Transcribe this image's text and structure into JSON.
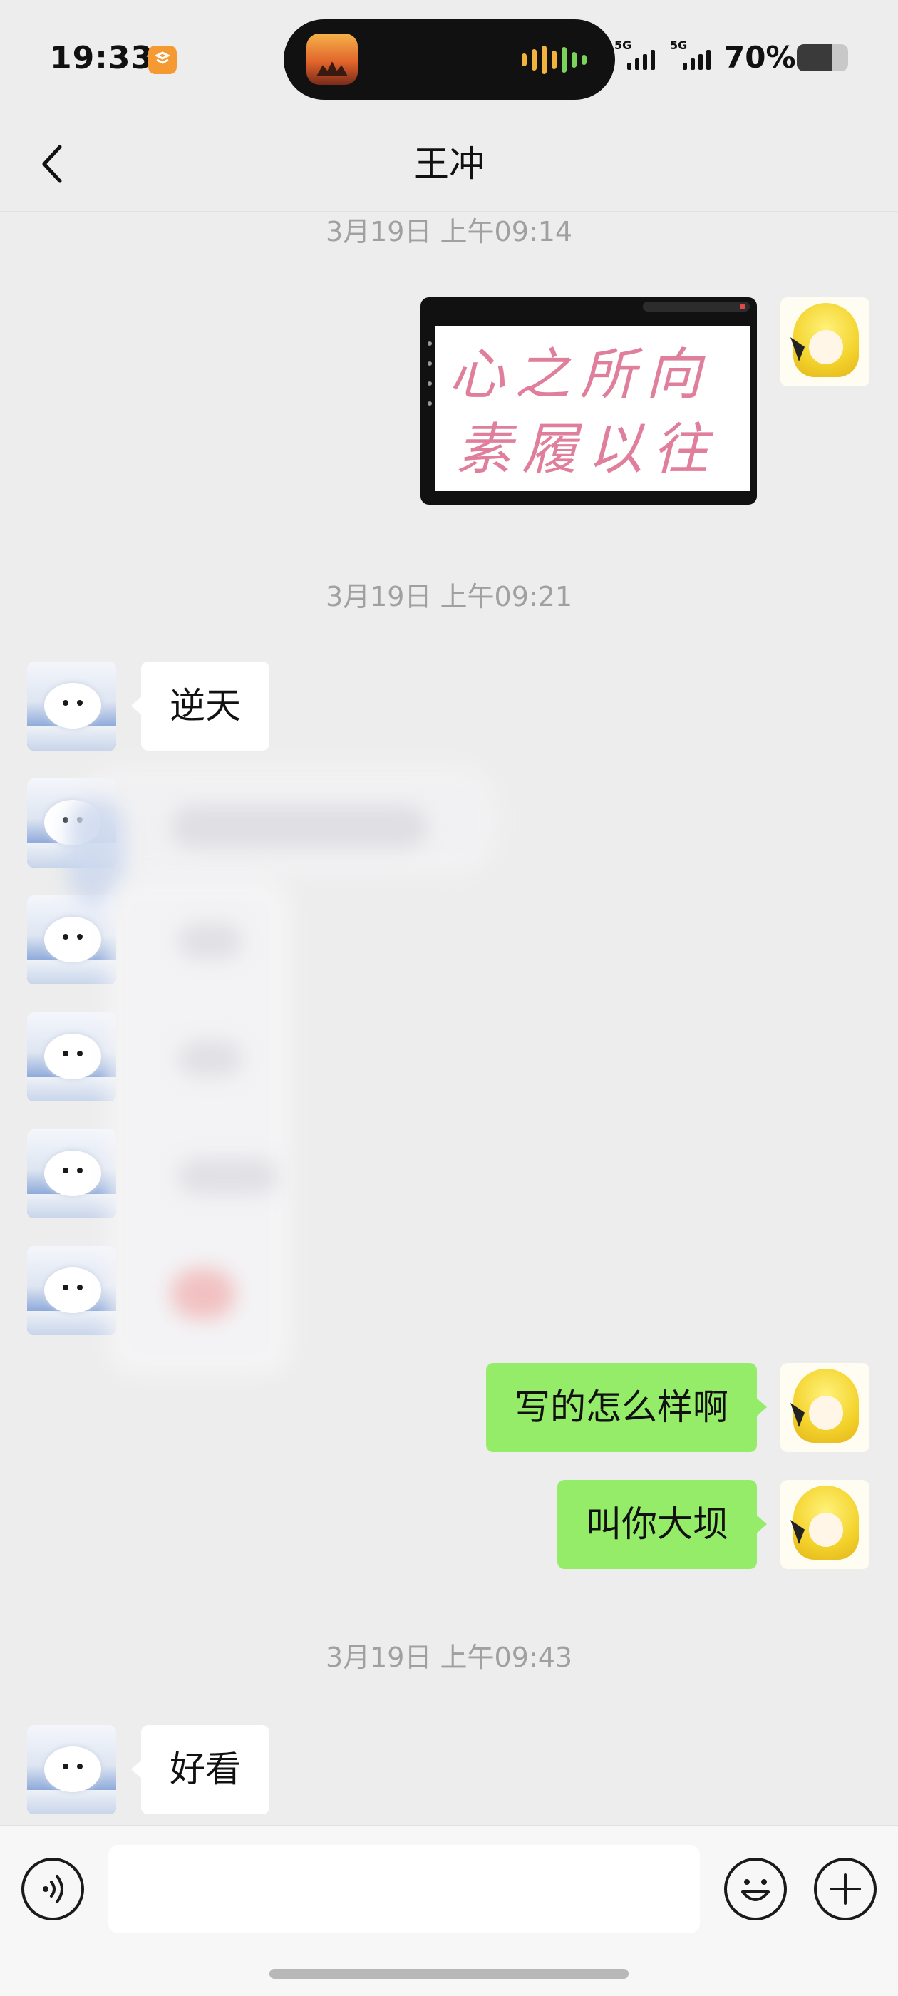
{
  "status": {
    "time": "19:33",
    "sim1": "5G",
    "sim2": "5G",
    "battery_percent": "70%",
    "battery_level": 0.7
  },
  "header": {
    "title": "王冲"
  },
  "messages": {
    "ts1": "3月19日 上午09:14",
    "ts2": "3月19日 上午09:21",
    "ts3": "3月19日 上午09:43",
    "in1": "逆天",
    "out1": "写的怎么样啊",
    "out2": "叫你大坝",
    "in2": "好看"
  },
  "image_message": {
    "line1": "心之所向",
    "line2": "素履以往",
    "ink_color": "#e07f9c"
  },
  "icons": {
    "back": "chevron-left-icon",
    "voice": "voice-icon",
    "emoji": "emoji-icon",
    "more": "plus-icon"
  },
  "colors": {
    "background": "#ededed",
    "outgoing_bubble": "#95ec69",
    "incoming_bubble": "#ffffff"
  }
}
